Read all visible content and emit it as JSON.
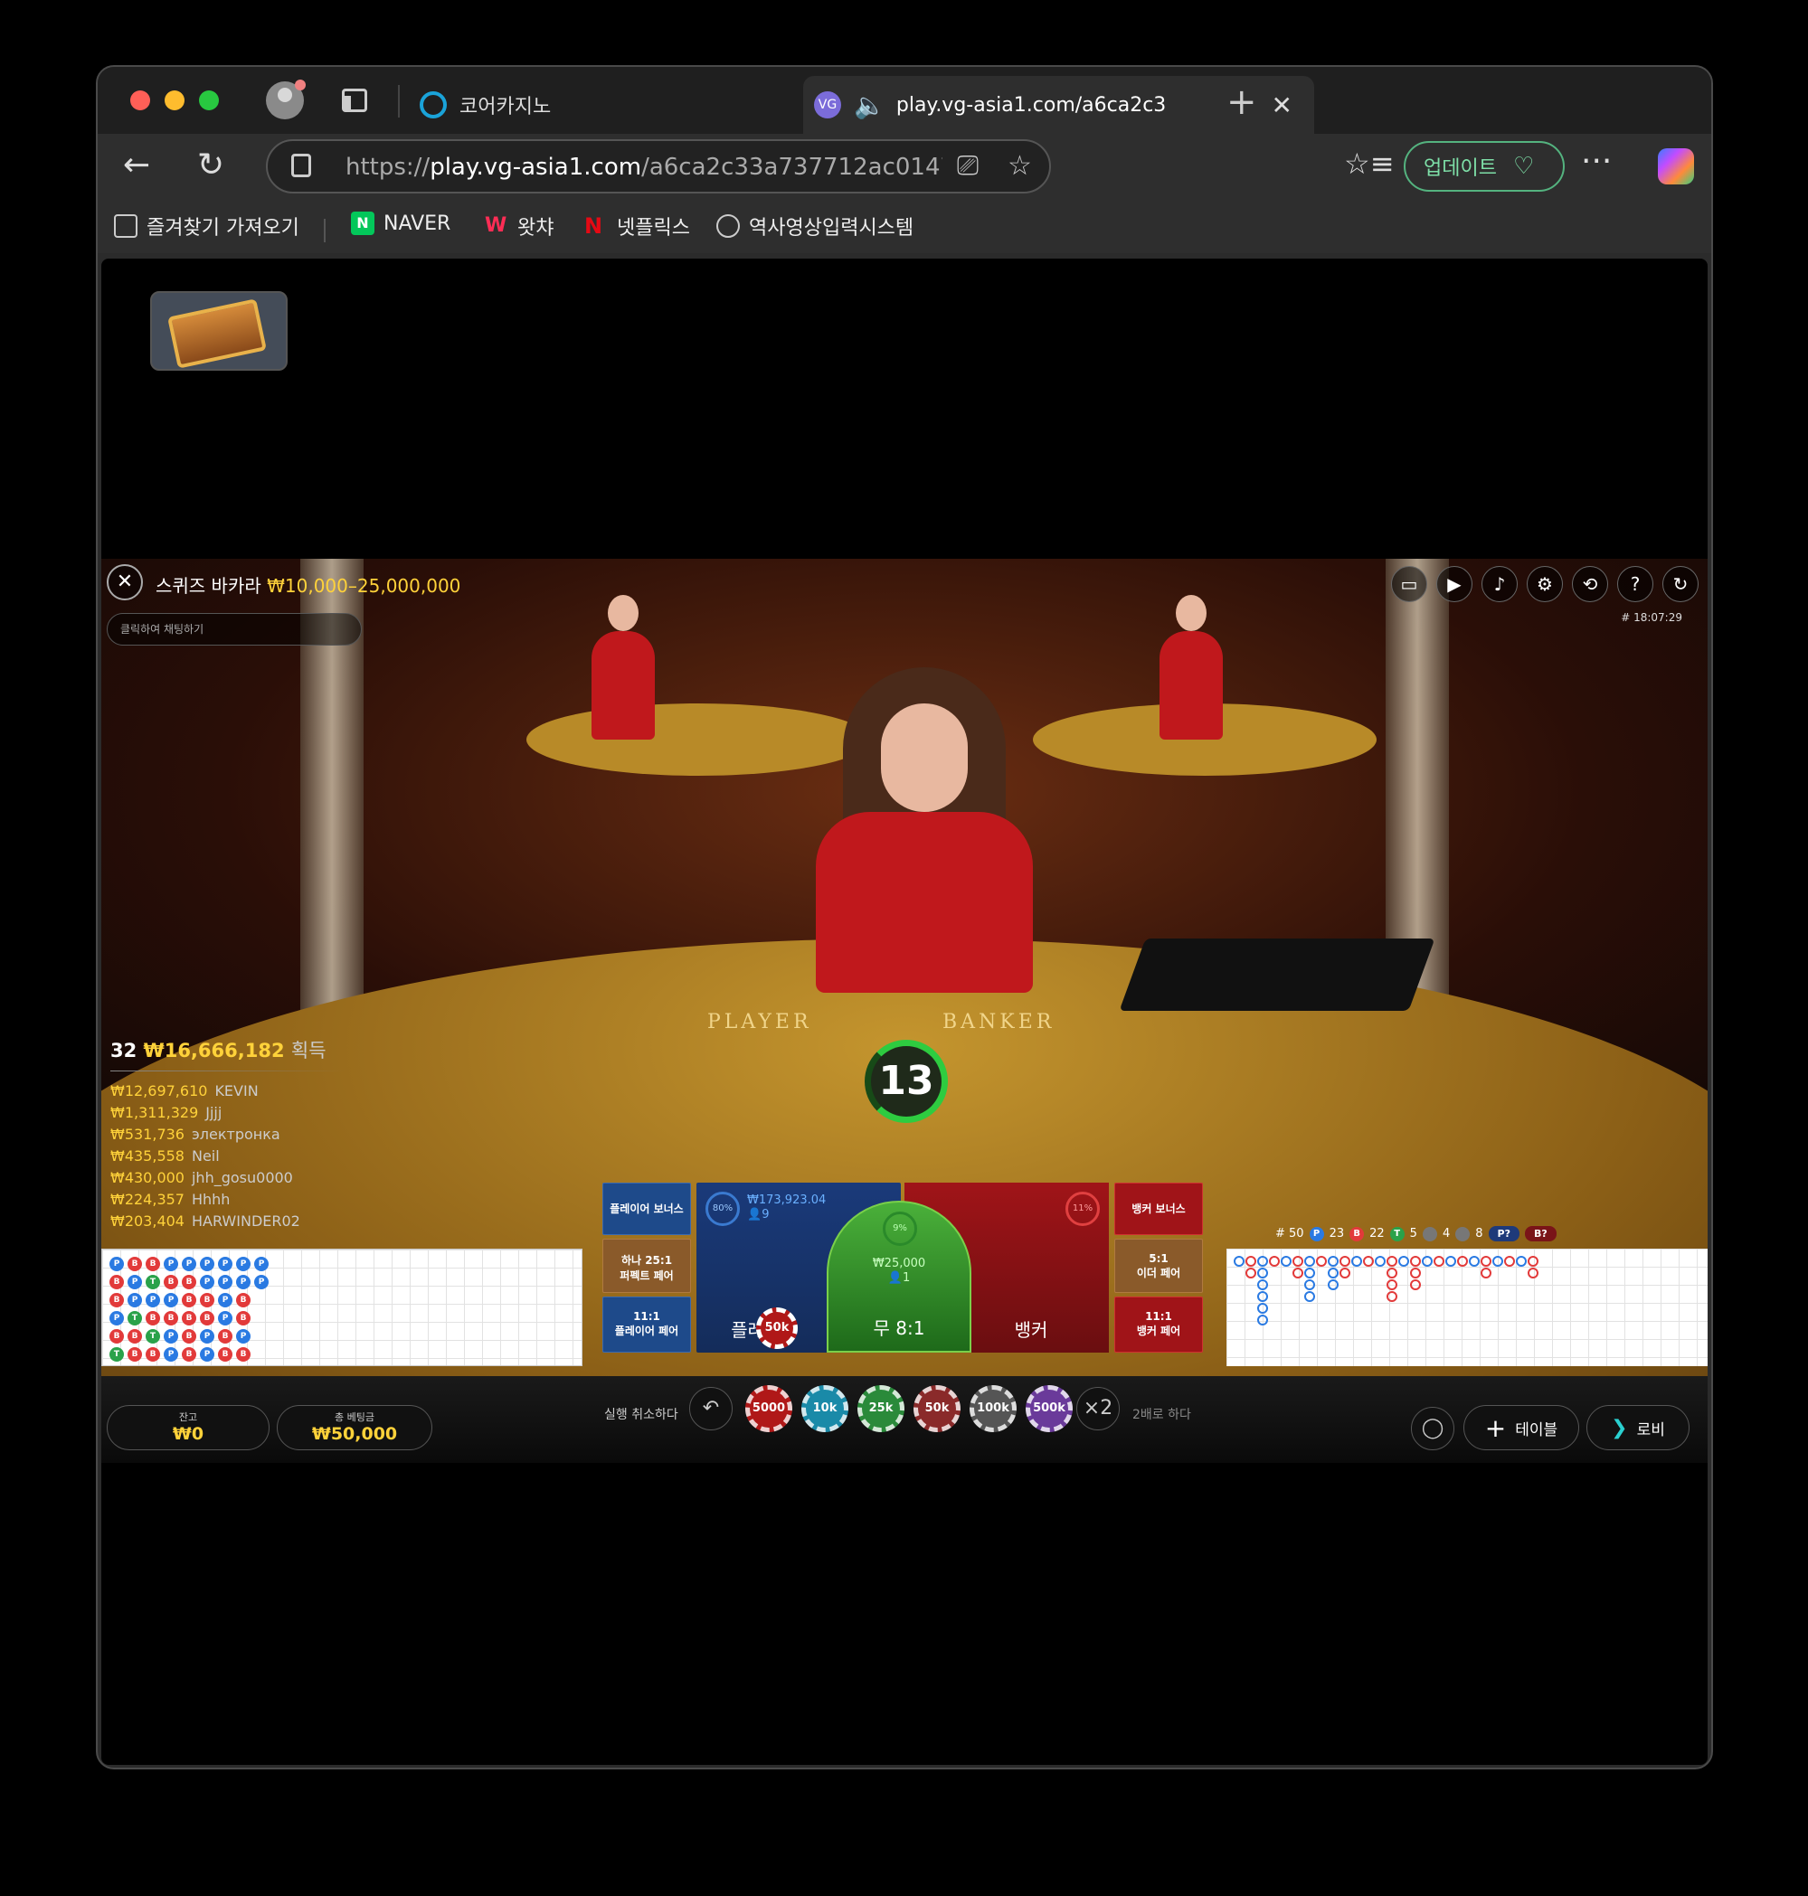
{
  "browser": {
    "tabs": [
      {
        "title": "코어카지노",
        "active": false
      },
      {
        "title": "play.vg-asia1.com/a6ca2c3",
        "active": true,
        "favicon_text": "VG"
      }
    ],
    "url_prefix": "https://",
    "url_host": "play.vg-asia1.com",
    "url_path": "/a6ca2c33a737712ac01479b12d93ad0b2cm1...",
    "update_label": "업데이트",
    "bookmarks": [
      {
        "label": "즐겨찾기 가져오기",
        "icon": "import-icon"
      },
      {
        "label": "NAVER",
        "icon": "naver-icon"
      },
      {
        "label": "왓챠",
        "icon": "watcha-icon"
      },
      {
        "label": "넷플릭스",
        "icon": "netflix-icon"
      },
      {
        "label": "역사영상입력시스템",
        "icon": "globe-icon"
      }
    ]
  },
  "game": {
    "table_name": "스퀴즈 바카라",
    "limits": "₩10,000–25,000,000",
    "chat_placeholder": "클릭하여 채팅하기",
    "time": "# 18:07:29",
    "felt_player": "PLAYER",
    "felt_banker": "BANKER",
    "winners_count": "32",
    "winners_total": "₩16,666,182",
    "winners_label": "획득",
    "winners": [
      {
        "amount": "₩12,697,610",
        "name": "KEVIN"
      },
      {
        "amount": "₩1,311,329",
        "name": "Jjjj"
      },
      {
        "amount": "₩531,736",
        "name": "электронка"
      },
      {
        "amount": "₩435,558",
        "name": "Neil"
      },
      {
        "amount": "₩430,000",
        "name": "jhh_gosu0000"
      },
      {
        "amount": "₩224,357",
        "name": "Hhhh"
      },
      {
        "amount": "₩203,404",
        "name": "HARWINDER02"
      }
    ],
    "countdown": "13",
    "bets": {
      "player_bonus": "플레이어 보너스",
      "perfect_pair_odds": "하나 25:1",
      "perfect_pair": "퍼펙트 페어",
      "player_pair_odds": "11:1",
      "player_pair": "플레이어 페어",
      "player_label": "플레이어",
      "player_pct": "80%",
      "player_amount": "₩173,923.04",
      "player_count": "9",
      "tie_label": "무 8:1",
      "tie_pct": "9%",
      "tie_amount": "₩25,000",
      "tie_count": "1",
      "banker_label": "뱅커",
      "banker_pct": "11%",
      "banker_bonus": "뱅커 보너스",
      "either_pair_odds": "5:1",
      "either_pair": "이더 페어",
      "banker_pair_odds": "11:1",
      "banker_pair": "뱅커 페어",
      "placed_chip": "50k"
    },
    "stats": {
      "round": "# 50",
      "player": "23",
      "banker": "22",
      "tie": "5",
      "player_pair": "4",
      "banker_pair": "8",
      "p_predict": "P?",
      "b_predict": "B?"
    },
    "bead_road": [
      [
        "P",
        "B",
        "B",
        "P",
        "P",
        "P",
        "P",
        "P",
        "P"
      ],
      [
        "B",
        "P",
        "T",
        "B",
        "B",
        "P",
        "P",
        "P",
        "P"
      ],
      [
        "B",
        "P",
        "P",
        "P",
        "B",
        "B",
        "P",
        "B"
      ],
      [
        "P",
        "T",
        "B",
        "B",
        "B",
        "B",
        "P",
        "B"
      ],
      [
        "B",
        "B",
        "T",
        "P",
        "B",
        "P",
        "B",
        "P"
      ],
      [
        "T",
        "B",
        "B",
        "P",
        "B",
        "P",
        "B",
        "B"
      ]
    ],
    "balance_label": "잔고",
    "balance": "₩0",
    "total_bet_label": "총 베팅금",
    "total_bet": "₩50,000",
    "undo_label": "실행 취소하다",
    "chips": [
      "5000",
      "10k",
      "25k",
      "50k",
      "100k",
      "500k"
    ],
    "double_label": "2배로 하다",
    "double_icon": "×2",
    "table_button": "테이블",
    "lobby_button": "로비",
    "colors": {
      "gold": "#ffd23a",
      "player_blue": "#1e4a8a",
      "banker_red": "#a01418",
      "tie_green": "#4ab03a"
    }
  }
}
